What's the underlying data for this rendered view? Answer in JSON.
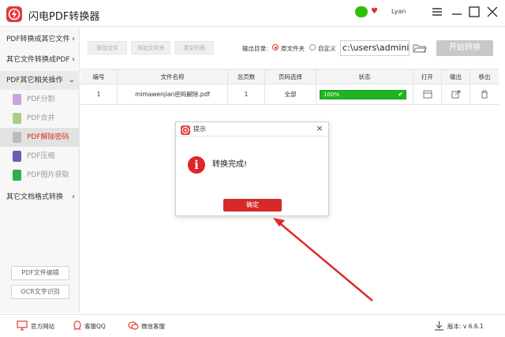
{
  "app": {
    "title": "闪电PDF转换器",
    "user": "Lyan"
  },
  "sidebar": {
    "items": [
      {
        "label": "PDF转换成其它文件",
        "arrow": "›"
      },
      {
        "label": "其它文件转换成PDF",
        "arrow": "›"
      },
      {
        "label": "PDF其它相关操作",
        "arrow": "⌄"
      }
    ],
    "sub_items": [
      {
        "label": "PDF分割",
        "color": "#c8a3e0"
      },
      {
        "label": "PDF合并",
        "color": "#a8cf8a"
      },
      {
        "label": "PDF解除密码",
        "color": "#bbbbbb"
      },
      {
        "label": "PDF压缩",
        "color": "#6b5fb5"
      },
      {
        "label": "PDF图片获取",
        "color": "#2fae4f"
      }
    ],
    "other": {
      "label": "其它文档格式转换",
      "arrow": "›"
    },
    "buttons": {
      "edit": "PDF文件编辑",
      "ocr": "OCR文字识别"
    }
  },
  "toolbar": {
    "add_file": "添加文件",
    "add_folder": "添加文件夹",
    "clear_list": "清空列表",
    "output_label": "输出目录:",
    "radio_source": "原文件夹",
    "radio_custom": "自定义",
    "path_value": "c:\\users\\administ",
    "start": "开始转换"
  },
  "table": {
    "headers": [
      "编号",
      "文件名称",
      "总页数",
      "页码选择",
      "状态",
      "打开",
      "输出",
      "移出"
    ],
    "rows": [
      {
        "num": "1",
        "name": "mimawenjian密码解除.pdf",
        "pages": "1",
        "range": "全部",
        "status": "100%",
        "progress": 1.0
      }
    ]
  },
  "dialog": {
    "title": "提示",
    "message": "转换完成!",
    "ok": "确定",
    "close": "×"
  },
  "footer": {
    "site": "官方网站",
    "qq": "客服QQ",
    "wechat": "微信客服",
    "version": "版本: v 6.6.1"
  },
  "colors": {
    "brand": "#e33b36",
    "progress": "#1fb41f",
    "arrow": "#e02a2a"
  }
}
